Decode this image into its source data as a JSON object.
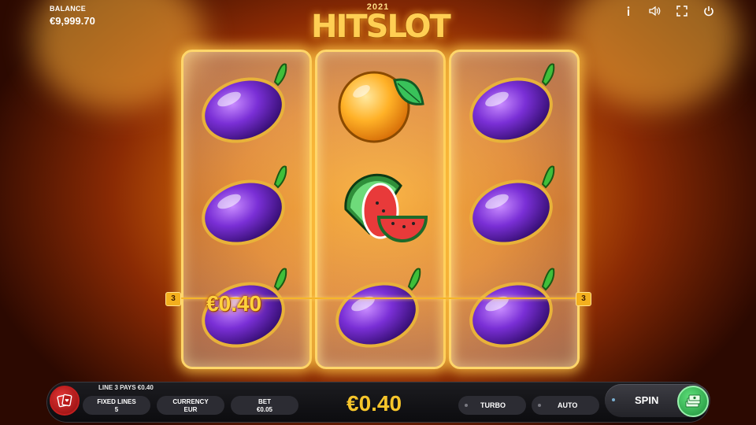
{
  "header": {
    "balance_label": "BALANCE",
    "balance_value": "€9,999.70",
    "logo_year": "2021",
    "logo_name": "HITSLOT",
    "icons": [
      "info-icon",
      "sound-icon",
      "fullscreen-icon",
      "power-icon"
    ]
  },
  "reels": [
    [
      "plum",
      "plum",
      "plum"
    ],
    [
      "orange",
      "watermelon",
      "plum"
    ],
    [
      "plum",
      "plum",
      "plum"
    ]
  ],
  "payline": {
    "left_number": "3",
    "right_number": "3",
    "win_amount": "€0.40"
  },
  "bottom": {
    "message": "LINE 3 PAYS €0.40",
    "fixed_lines_label": "FIXED LINES",
    "fixed_lines_value": "5",
    "currency_label": "CURRENCY",
    "currency_value": "EUR",
    "bet_label": "BET",
    "bet_value": "€0.05",
    "total_win": "€0.40",
    "turbo_label": "TURBO",
    "auto_label": "AUTO",
    "spin_label": "SPIN"
  },
  "colors": {
    "accent_gold": "#f6c52b",
    "plum": "#7a2fd6",
    "spin_green": "#2fbf55",
    "cards_red": "#d62b2b"
  }
}
